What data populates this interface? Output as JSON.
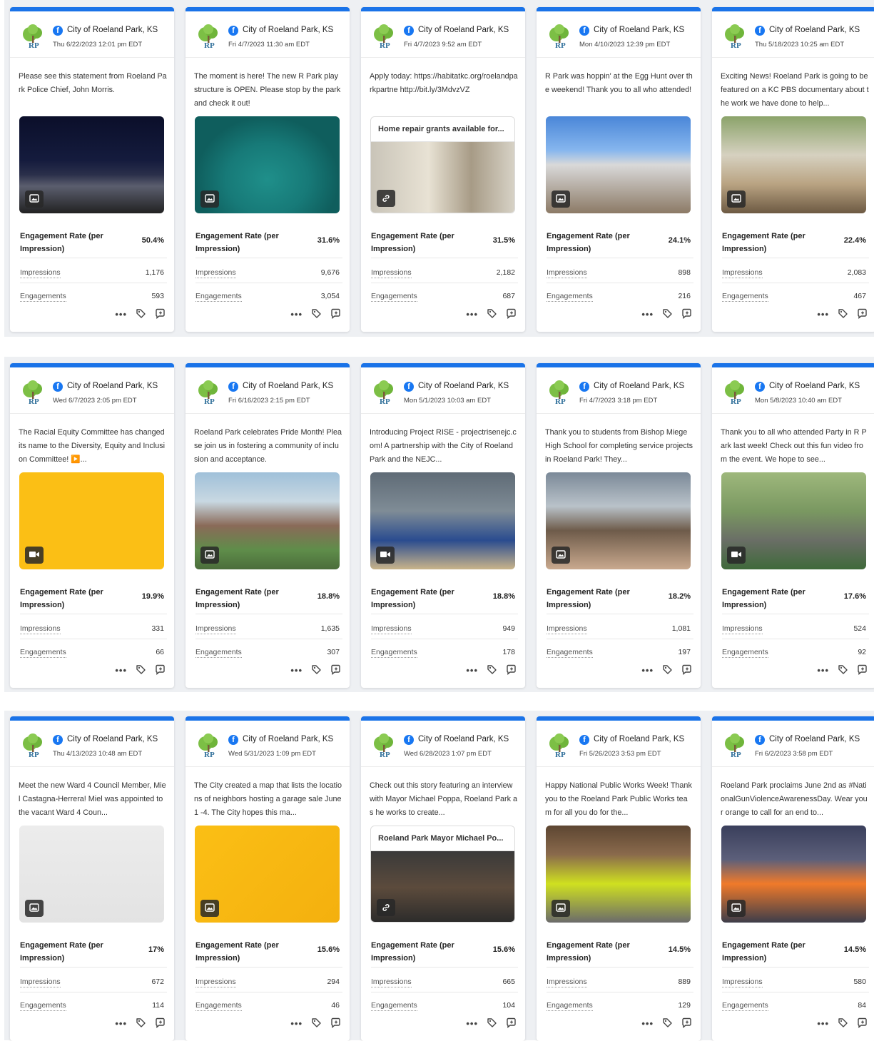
{
  "page_name": "City of Roeland Park, KS",
  "labels": {
    "engagement_rate": "Engagement Rate (per Impression)",
    "impressions": "Impressions",
    "engagements": "Engagements"
  },
  "icons": {
    "brand": "facebook-icon",
    "more": "more-options-icon",
    "tag": "tag-icon",
    "reply": "reply-icon",
    "photo": "photo-icon",
    "video": "video-icon",
    "link": "link-icon"
  },
  "colors": {
    "accent": "#1a73e8",
    "facebook": "#1877f2",
    "logo_green": "#6fb53a"
  },
  "posts": [
    {
      "date": "Thu 6/22/2023 12:01 pm EDT",
      "text": "Please see this statement from Roeland Park Police Chief, John Morris.",
      "media_type": "photo",
      "link_title": "",
      "engagement_rate": "50.4%",
      "impressions": "1,176",
      "engagements": "593"
    },
    {
      "date": "Fri 4/7/2023 11:30 am EDT",
      "text": "The moment is here! The new R Park play structure is OPEN. Please stop by the park and check it out!",
      "media_type": "photo",
      "link_title": "",
      "engagement_rate": "31.6%",
      "impressions": "9,676",
      "engagements": "3,054"
    },
    {
      "date": "Fri 4/7/2023 9:52 am EDT",
      "text": "Apply today: https://habitatkc.org/roelandparkpartne http://bit.ly/3MdvzVZ",
      "media_type": "link",
      "link_title": "Home repair grants available for...",
      "engagement_rate": "31.5%",
      "impressions": "2,182",
      "engagements": "687"
    },
    {
      "date": "Mon 4/10/2023 12:39 pm EDT",
      "text": "R Park was hoppin' at the Egg Hunt over the weekend! Thank you to all who attended!",
      "media_type": "photo",
      "link_title": "",
      "engagement_rate": "24.1%",
      "impressions": "898",
      "engagements": "216"
    },
    {
      "date": "Thu 5/18/2023 10:25 am EDT",
      "text": "Exciting News! Roeland Park is going to be featured on a KC PBS documentary about the work we have done to help...",
      "media_type": "photo",
      "link_title": "",
      "engagement_rate": "22.4%",
      "impressions": "2,083",
      "engagements": "467"
    },
    {
      "date": "Wed 6/7/2023 2:05 pm EDT",
      "text": "The Racial Equity Committee has changed its name to the Diversity, Equity and Inclusion Committee! ▶️...",
      "media_type": "video",
      "link_title": "",
      "engagement_rate": "19.9%",
      "impressions": "331",
      "engagements": "66"
    },
    {
      "date": "Fri 6/16/2023 2:15 pm EDT",
      "text": "Roeland Park celebrates Pride Month! Please join us in fostering a community of inclusion and acceptance.",
      "media_type": "photo",
      "link_title": "",
      "engagement_rate": "18.8%",
      "impressions": "1,635",
      "engagements": "307"
    },
    {
      "date": "Mon 5/1/2023 10:03 am EDT",
      "text": "Introducing Project RISE - projectrisenejc.com! A partnership with the City of Roeland Park and the NEJC...",
      "media_type": "video",
      "link_title": "",
      "engagement_rate": "18.8%",
      "impressions": "949",
      "engagements": "178"
    },
    {
      "date": "Fri 4/7/2023 3:18 pm EDT",
      "text": "Thank you to students from Bishop Miege High School for completing service projects in Roeland Park! They...",
      "media_type": "photo",
      "link_title": "",
      "engagement_rate": "18.2%",
      "impressions": "1,081",
      "engagements": "197"
    },
    {
      "date": "Mon 5/8/2023 10:40 am EDT",
      "text": "Thank you to all who attended Party in R Park last week! Check out this fun video from the event. We hope to see...",
      "media_type": "video",
      "link_title": "",
      "engagement_rate": "17.6%",
      "impressions": "524",
      "engagements": "92"
    },
    {
      "date": "Thu 4/13/2023 10:48 am EDT",
      "text": "Meet the new Ward 4 Council Member, Miel Castagna-Herrera! Miel was appointed to the vacant Ward 4 Coun...",
      "media_type": "photo",
      "link_title": "",
      "engagement_rate": "17%",
      "impressions": "672",
      "engagements": "114"
    },
    {
      "date": "Wed 5/31/2023 1:09 pm EDT",
      "text": "The City created a map that lists the locations of neighbors hosting a garage sale June 1 -4. The City hopes this ma...",
      "media_type": "photo",
      "link_title": "",
      "engagement_rate": "15.6%",
      "impressions": "294",
      "engagements": "46"
    },
    {
      "date": "Wed 6/28/2023 1:07 pm EDT",
      "text": "Check out this story featuring an interview with Mayor Michael Poppa, Roeland Park as he works to create...",
      "media_type": "link",
      "link_title": "Roeland Park Mayor Michael Po...",
      "engagement_rate": "15.6%",
      "impressions": "665",
      "engagements": "104"
    },
    {
      "date": "Fri 5/26/2023 3:53 pm EDT",
      "text": "Happy National Public Works Week! Thank you to the Roeland Park Public Works team for all you do for the...",
      "media_type": "photo",
      "link_title": "",
      "engagement_rate": "14.5%",
      "impressions": "889",
      "engagements": "129"
    },
    {
      "date": "Fri 6/2/2023 3:58 pm EDT",
      "text": "Roeland Park proclaims June 2nd as #NationalGunViolenceAwarenessDay. Wear your orange to call for an end to...",
      "media_type": "photo",
      "link_title": "",
      "engagement_rate": "14.5%",
      "impressions": "580",
      "engagements": "84"
    }
  ]
}
